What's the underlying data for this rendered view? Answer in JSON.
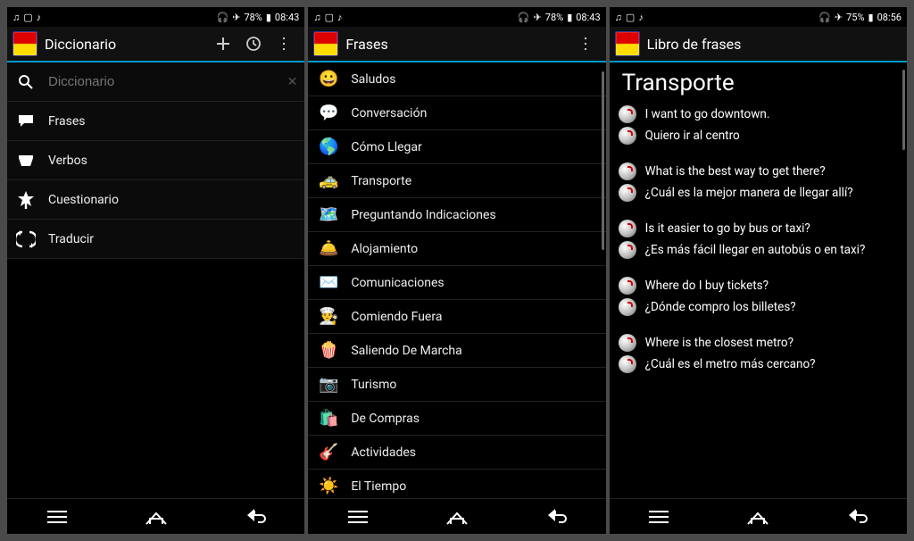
{
  "phones": [
    {
      "status": {
        "battery": "78%",
        "time": "08:43"
      },
      "title": "Diccionario",
      "menu": [
        {
          "icon": "search",
          "label": "Diccionario"
        },
        {
          "icon": "speech",
          "label": "Frases"
        },
        {
          "icon": "book",
          "label": "Verbos"
        },
        {
          "icon": "star",
          "label": "Cuestionario"
        },
        {
          "icon": "loop",
          "label": "Traducir"
        }
      ]
    },
    {
      "status": {
        "battery": "78%",
        "time": "08:43"
      },
      "title": "Frases",
      "categories": [
        {
          "label": "Saludos",
          "emoji": "😀",
          "bg": ""
        },
        {
          "label": "Conversación",
          "emoji": "💬",
          "bg": ""
        },
        {
          "label": "Cómo Llegar",
          "emoji": "🌎",
          "bg": ""
        },
        {
          "label": "Transporte",
          "emoji": "🚕",
          "bg": ""
        },
        {
          "label": "Preguntando Indicaciones",
          "emoji": "🗺️",
          "bg": ""
        },
        {
          "label": "Alojamiento",
          "emoji": "🛎️",
          "bg": ""
        },
        {
          "label": "Comunicaciones",
          "emoji": "✉️",
          "bg": ""
        },
        {
          "label": "Comiendo Fuera",
          "emoji": "👨‍🍳",
          "bg": ""
        },
        {
          "label": "Saliendo De Marcha",
          "emoji": "🍿",
          "bg": ""
        },
        {
          "label": "Turismo",
          "emoji": "📷",
          "bg": ""
        },
        {
          "label": "De Compras",
          "emoji": "🛍️",
          "bg": ""
        },
        {
          "label": "Actividades",
          "emoji": "🎸",
          "bg": ""
        },
        {
          "label": "El Tiempo",
          "emoji": "☀️",
          "bg": ""
        }
      ]
    },
    {
      "status": {
        "battery": "75%",
        "time": "08:56"
      },
      "title": "Libro de frases",
      "page_heading": "Transporte",
      "phrases": [
        {
          "en": "I want to go downtown.",
          "es": "Quiero ir al centro"
        },
        {
          "en": "What is the best way to get there?",
          "es": "¿Cuál es la mejor manera de llegar allí?"
        },
        {
          "en": "Is it easier to go by bus or taxi?",
          "es": "¿Es más fácil llegar en autobús o en taxi?"
        },
        {
          "en": "Where do I buy tickets?",
          "es": "¿Dónde compro los billetes?"
        },
        {
          "en": "Where is the closest metro?",
          "es": "¿Cuál es el metro más cercano?"
        }
      ]
    }
  ]
}
